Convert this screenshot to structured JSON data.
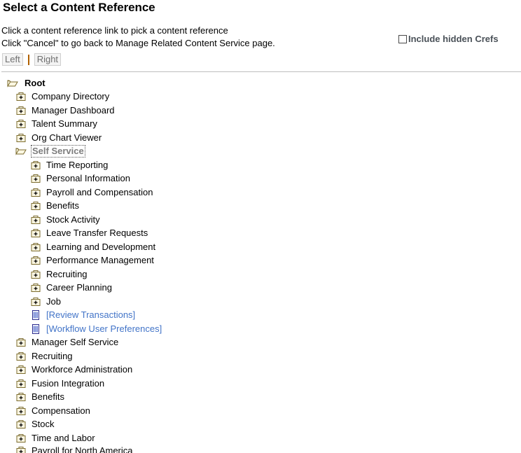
{
  "page": {
    "title": "Select a Content Reference",
    "instruction_line_1": "Click a content reference link to pick a content reference",
    "instruction_line_2": "Click \"Cancel\" to go back to Manage Related Content Service page."
  },
  "options": {
    "include_hidden_crefs_label": "Include hidden Crefs",
    "include_hidden_crefs_checked": false
  },
  "tabs": {
    "left_label": "Left",
    "right_label": "Right",
    "separator": "|"
  },
  "colors": {
    "link": "#4274c8",
    "selected_text": "#7d7d7d",
    "folder_outline": "#7b6b2d",
    "folder_fill": "#fdf8e3",
    "tab_separator": "#b06000",
    "checkbox_label": "#4a5158",
    "divider": "#bdbdbd"
  },
  "tree": {
    "nodes": [
      {
        "label": "Root",
        "level": 0,
        "icon": "open-folder-icon",
        "state": "expanded",
        "style": "root"
      },
      {
        "label": "Company Directory",
        "level": 1,
        "icon": "closed-folder-plus-icon",
        "state": "collapsed",
        "style": "normal"
      },
      {
        "label": "Manager Dashboard",
        "level": 1,
        "icon": "closed-folder-plus-icon",
        "state": "collapsed",
        "style": "normal"
      },
      {
        "label": "Talent Summary",
        "level": 1,
        "icon": "closed-folder-plus-icon",
        "state": "collapsed",
        "style": "normal"
      },
      {
        "label": "Org Chart Viewer",
        "level": 1,
        "icon": "closed-folder-plus-icon",
        "state": "collapsed",
        "style": "normal"
      },
      {
        "label": "Self Service",
        "level": 1,
        "icon": "open-folder-icon",
        "state": "expanded",
        "style": "selected"
      },
      {
        "label": "Time Reporting",
        "level": 2,
        "icon": "closed-folder-plus-icon",
        "state": "collapsed",
        "style": "normal"
      },
      {
        "label": "Personal Information",
        "level": 2,
        "icon": "closed-folder-plus-icon",
        "state": "collapsed",
        "style": "normal"
      },
      {
        "label": "Payroll and Compensation",
        "level": 2,
        "icon": "closed-folder-plus-icon",
        "state": "collapsed",
        "style": "normal"
      },
      {
        "label": "Benefits",
        "level": 2,
        "icon": "closed-folder-plus-icon",
        "state": "collapsed",
        "style": "normal"
      },
      {
        "label": "Stock Activity",
        "level": 2,
        "icon": "closed-folder-plus-icon",
        "state": "collapsed",
        "style": "normal"
      },
      {
        "label": "Leave Transfer Requests",
        "level": 2,
        "icon": "closed-folder-plus-icon",
        "state": "collapsed",
        "style": "normal"
      },
      {
        "label": "Learning and Development",
        "level": 2,
        "icon": "closed-folder-plus-icon",
        "state": "collapsed",
        "style": "normal"
      },
      {
        "label": "Performance Management",
        "level": 2,
        "icon": "closed-folder-plus-icon",
        "state": "collapsed",
        "style": "normal"
      },
      {
        "label": "Recruiting",
        "level": 2,
        "icon": "closed-folder-plus-icon",
        "state": "collapsed",
        "style": "normal"
      },
      {
        "label": "Career Planning",
        "level": 2,
        "icon": "closed-folder-plus-icon",
        "state": "collapsed",
        "style": "normal"
      },
      {
        "label": "Job",
        "level": 2,
        "icon": "closed-folder-plus-icon",
        "state": "collapsed",
        "style": "normal"
      },
      {
        "label": "[Review Transactions]",
        "level": 2,
        "icon": "document-icon",
        "state": "leaf",
        "style": "link"
      },
      {
        "label": "[Workflow User Preferences]",
        "level": 2,
        "icon": "document-icon",
        "state": "leaf",
        "style": "link"
      },
      {
        "label": "Manager Self Service",
        "level": 1,
        "icon": "closed-folder-plus-icon",
        "state": "collapsed",
        "style": "normal"
      },
      {
        "label": "Recruiting",
        "level": 1,
        "icon": "closed-folder-plus-icon",
        "state": "collapsed",
        "style": "normal"
      },
      {
        "label": "Workforce Administration",
        "level": 1,
        "icon": "closed-folder-plus-icon",
        "state": "collapsed",
        "style": "normal"
      },
      {
        "label": "Fusion Integration",
        "level": 1,
        "icon": "closed-folder-plus-icon",
        "state": "collapsed",
        "style": "normal"
      },
      {
        "label": "Benefits",
        "level": 1,
        "icon": "closed-folder-plus-icon",
        "state": "collapsed",
        "style": "normal"
      },
      {
        "label": "Compensation",
        "level": 1,
        "icon": "closed-folder-plus-icon",
        "state": "collapsed",
        "style": "normal"
      },
      {
        "label": "Stock",
        "level": 1,
        "icon": "closed-folder-plus-icon",
        "state": "collapsed",
        "style": "normal"
      },
      {
        "label": "Time and Labor",
        "level": 1,
        "icon": "closed-folder-plus-icon",
        "state": "collapsed",
        "style": "normal"
      },
      {
        "label": "Payroll for North America",
        "level": 1,
        "icon": "closed-folder-plus-icon",
        "state": "collapsed",
        "style": "normal",
        "clipped": true
      }
    ]
  }
}
